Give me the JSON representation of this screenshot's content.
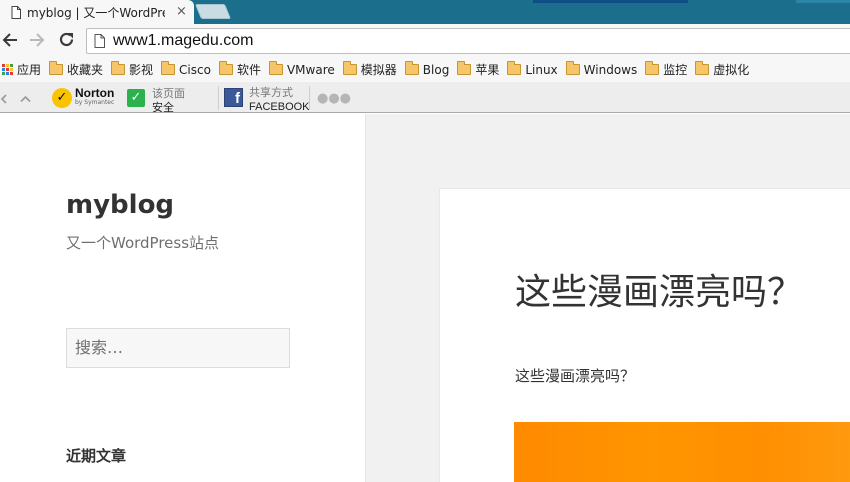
{
  "browser": {
    "tab_title": "myblog | 又一个WordPress站点",
    "tab_close": "×",
    "url": "www1.magedu.com",
    "bookmarks": [
      {
        "label": "应用",
        "icon": "apps-grid-icon"
      },
      {
        "label": "收藏夹",
        "icon": "folder-icon"
      },
      {
        "label": "影视",
        "icon": "folder-icon"
      },
      {
        "label": "Cisco",
        "icon": "folder-icon"
      },
      {
        "label": "软件",
        "icon": "folder-icon"
      },
      {
        "label": "VMware",
        "icon": "folder-icon"
      },
      {
        "label": "模拟器",
        "icon": "folder-icon"
      },
      {
        "label": "Blog",
        "icon": "folder-icon"
      },
      {
        "label": "苹果",
        "icon": "folder-icon"
      },
      {
        "label": "Linux",
        "icon": "folder-icon"
      },
      {
        "label": "Windows",
        "icon": "folder-icon"
      },
      {
        "label": "监控",
        "icon": "folder-icon"
      },
      {
        "label": "虚拟化",
        "icon": "folder-icon"
      }
    ],
    "extensions": {
      "norton_brand": "Norton",
      "norton_sub": "by Symantec",
      "safe_line1": "该页面",
      "safe_line2": "安全",
      "share_line1": "共享方式",
      "share_line2": "FACEBOOK",
      "more": "●●●"
    }
  },
  "page": {
    "site_title": "myblog",
    "site_description": "又一个WordPress站点",
    "search_placeholder": "搜索…",
    "widget_title": "近期文章",
    "entry_title": "这些漫画漂亮吗？",
    "entry_content": "这些漫画漂亮吗？"
  },
  "colors": {
    "tabstrip": "#1c6f8c",
    "toolbar": "#f7f7f7",
    "content_background": "#f1f1f1",
    "image_orange": "#ff8f00",
    "norton_yellow": "#f9c300",
    "safe_green": "#2bb24c",
    "facebook_blue": "#3b5998"
  }
}
